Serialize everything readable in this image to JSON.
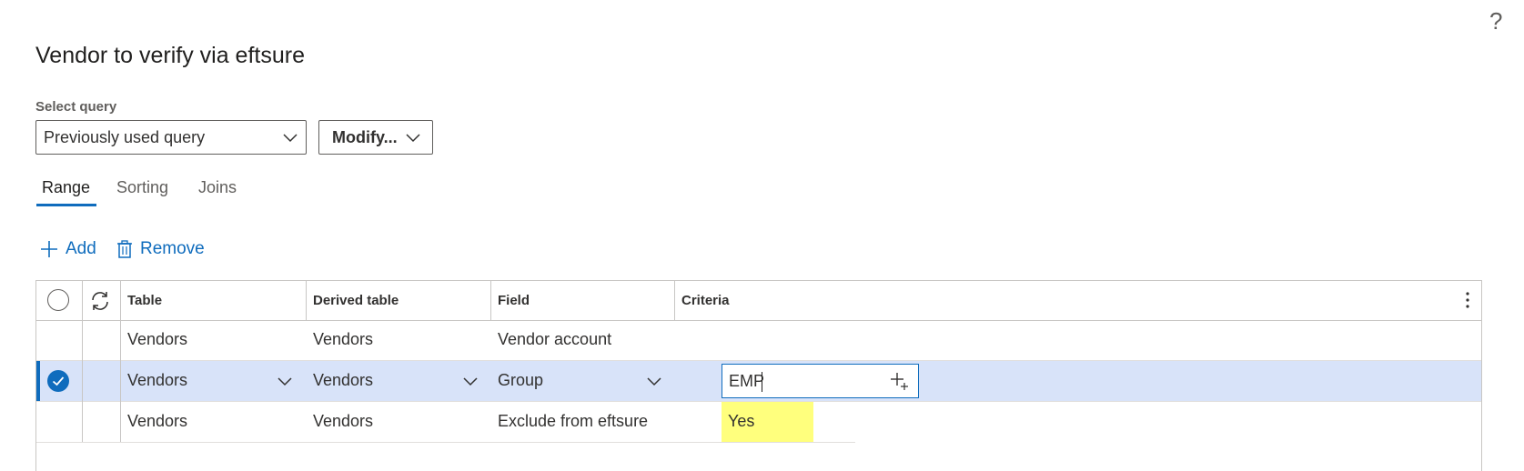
{
  "help": {
    "icon": "help-icon",
    "label": "?"
  },
  "page": {
    "title": "Vendor to verify via eftsure"
  },
  "query": {
    "label": "Select query",
    "selected": "Previously used query",
    "modify_label": "Modify..."
  },
  "tabs": [
    {
      "label": "Range",
      "active": true
    },
    {
      "label": "Sorting",
      "active": false
    },
    {
      "label": "Joins",
      "active": false
    }
  ],
  "actions": {
    "add_label": "Add",
    "remove_label": "Remove"
  },
  "grid": {
    "columns": [
      "Table",
      "Derived table",
      "Field",
      "Criteria"
    ],
    "rows": [
      {
        "table": "Vendors",
        "derived_table": "Vendors",
        "field": "Vendor account",
        "criteria": "",
        "selected": false
      },
      {
        "table": "Vendors",
        "derived_table": "Vendors",
        "field": "Group",
        "criteria": "EMP",
        "selected": true
      },
      {
        "table": "Vendors",
        "derived_table": "Vendors",
        "field": "Exclude from eftsure",
        "criteria": "Yes",
        "selected": false,
        "highlighted": true
      }
    ]
  },
  "colors": {
    "accent": "#0f6cbd",
    "selected_row": "#d8e3f9",
    "highlight": "#ffff66"
  }
}
